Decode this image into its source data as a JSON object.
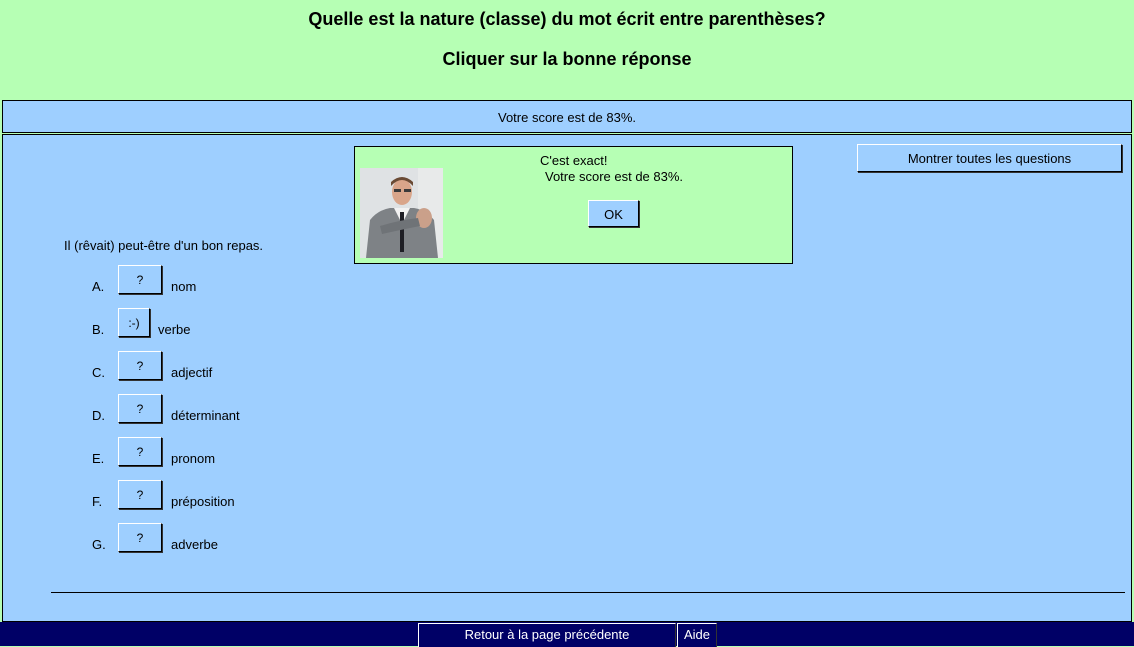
{
  "header": {
    "title": "Quelle est la nature (classe) du mot écrit entre parenthèses?",
    "subtitle": "Cliquer sur la bonne réponse"
  },
  "score_bar": {
    "text": "Votre score est de 83%."
  },
  "feedback": {
    "line1": "C'est exact!",
    "line2": "Votre score est de 83%.",
    "ok_label": "OK"
  },
  "show_all_label": "Montrer toutes les questions",
  "question": {
    "text": "Il (rêvait) peut-être d'un bon repas."
  },
  "options": [
    {
      "letter": "A.",
      "button": "?",
      "label": "nom"
    },
    {
      "letter": "B.",
      "button": ":-)",
      "label": "verbe"
    },
    {
      "letter": "C.",
      "button": "?",
      "label": "adjectif"
    },
    {
      "letter": "D.",
      "button": "?",
      "label": "déterminant"
    },
    {
      "letter": "E.",
      "button": "?",
      "label": "pronom"
    },
    {
      "letter": "F.",
      "button": "?",
      "label": "préposition"
    },
    {
      "letter": "G.",
      "button": "?",
      "label": "adverbe"
    }
  ],
  "footer": {
    "back_label": "Retour à la page précédente",
    "help_label": "Aide"
  },
  "colors": {
    "header_bg": "#b6ffb4",
    "panel_bg": "#9ecfff",
    "footer_bg": "#000066"
  }
}
